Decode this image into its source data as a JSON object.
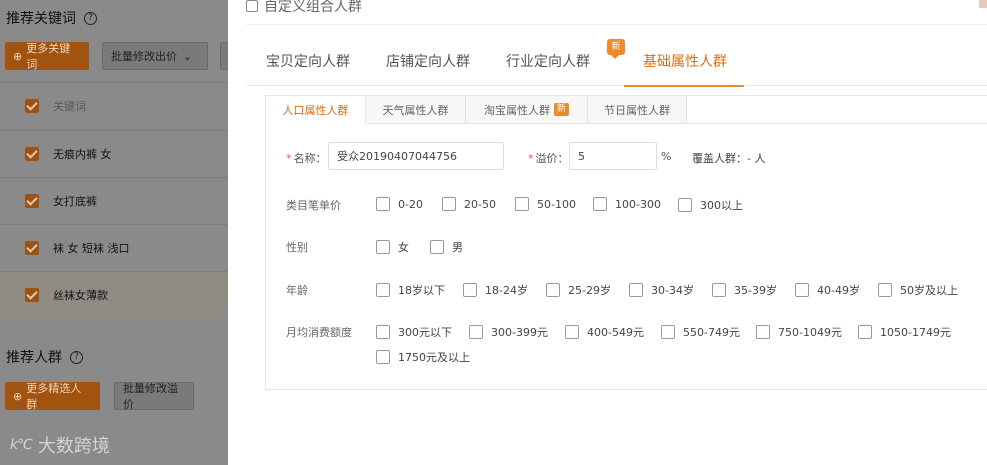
{
  "left": {
    "keywords_title": "推荐关键词",
    "more_keywords_btn": "更多关键词",
    "batch_bid_btn": "批量修改出价",
    "keyword_header": "关键词",
    "keywords": [
      "无痕内裤 女",
      "女打底裤",
      "袜 女 短袜 浅口",
      "丝袜女薄款"
    ],
    "audience_title": "推荐人群",
    "more_audience_btn": "更多精选人群",
    "batch_premium_btn": "批量修改溢价",
    "watermark_text": "大数跨境",
    "watermark_logo": "k℃"
  },
  "panel": {
    "title": "自定义组合人群",
    "main_tabs": [
      {
        "label": "宝贝定向人群"
      },
      {
        "label": "店铺定向人群"
      },
      {
        "label": "行业定向人群",
        "badge": "新"
      },
      {
        "label": "基础属性人群"
      }
    ],
    "sub_tabs": [
      {
        "label": "人口属性人群"
      },
      {
        "label": "天气属性人群"
      },
      {
        "label": "淘宝属性人群",
        "badge": "新"
      },
      {
        "label": "节日属性人群"
      }
    ],
    "form": {
      "name_label": "名称：",
      "name_value": "受众20190407044756",
      "premium_label": "溢价：",
      "premium_value": "5",
      "percent": "%",
      "coverage_label": "覆盖人群：",
      "coverage_value": "- 人",
      "required_mark": "*"
    },
    "groups": [
      {
        "label": "类目笔单价",
        "options": [
          "0-20",
          "20-50",
          "50-100",
          "100-300",
          "300以上"
        ]
      },
      {
        "label": "性别",
        "options": [
          "女",
          "男"
        ]
      },
      {
        "label": "年龄",
        "options": [
          "18岁以下",
          "18-24岁",
          "25-29岁",
          "30-34岁",
          "35-39岁",
          "40-49岁",
          "50岁及以上"
        ]
      },
      {
        "label": "月均消费额度",
        "options": [
          "300元以下",
          "300-399元",
          "400-549元",
          "550-749元",
          "750-1049元",
          "1050-1749元",
          "1750元及以上"
        ]
      }
    ]
  },
  "colors": {
    "accent": "#e26c0f",
    "badge": "#ef8a29"
  }
}
